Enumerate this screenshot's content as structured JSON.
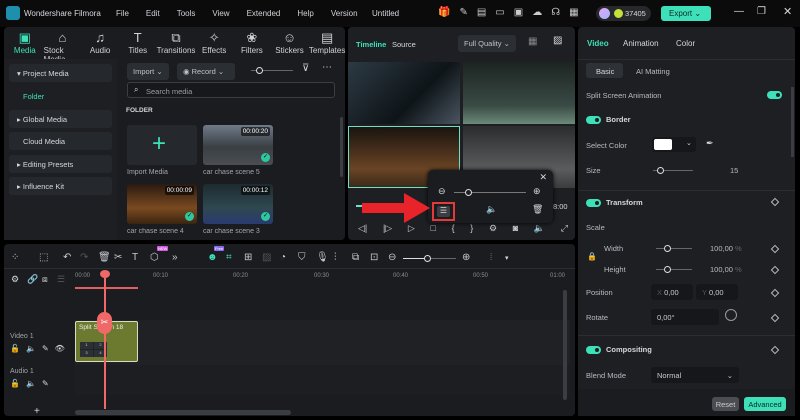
{
  "app": {
    "name": "Wondershare Filmora",
    "project_title": "Untitled",
    "credits": "37405",
    "export_label": "Export"
  },
  "menu": [
    "File",
    "Edit",
    "Tools",
    "View",
    "Extended",
    "Help",
    "Version"
  ],
  "toolbar_tabs": [
    {
      "label": "Media",
      "icon": "media-icon"
    },
    {
      "label": "Stock Media",
      "icon": "stock-media-icon"
    },
    {
      "label": "Audio",
      "icon": "audio-icon"
    },
    {
      "label": "Titles",
      "icon": "titles-icon"
    },
    {
      "label": "Transitions",
      "icon": "transitions-icon"
    },
    {
      "label": "Effects",
      "icon": "effects-icon"
    },
    {
      "label": "Filters",
      "icon": "filters-icon"
    },
    {
      "label": "Stickers",
      "icon": "stickers-icon"
    },
    {
      "label": "Templates",
      "icon": "templates-icon"
    }
  ],
  "media_sidebar": [
    "Project Media",
    "Folder",
    "Global Media",
    "Cloud Media",
    "Editing Presets",
    "Influence Kit"
  ],
  "media": {
    "import_label": "Import",
    "record_label": "Record",
    "search_placeholder": "Search media",
    "folder_heading": "FOLDER",
    "items": [
      {
        "name": "Import Media"
      },
      {
        "name": "car chase scene 5",
        "duration": "00:00:20"
      },
      {
        "name": "car chase scene 4",
        "duration": "00:00:09"
      },
      {
        "name": "car chase scene 3",
        "duration": "00:00:12"
      }
    ]
  },
  "preview": {
    "tabs": [
      "Timeline",
      "Source"
    ],
    "quality": "Full Quality",
    "time_end": "8:00",
    "popup_zoom_fraction": 0.2
  },
  "properties": {
    "tabs": [
      "Video",
      "Animation",
      "Color"
    ],
    "subtabs": [
      "Basic",
      "AI Matting"
    ],
    "split_screen_animation": "Split Screen Animation",
    "border": {
      "title": "Border",
      "select_color": "Select Color",
      "size_label": "Size",
      "size_value": "15"
    },
    "transform": {
      "title": "Transform",
      "scale": "Scale",
      "width_label": "Width",
      "width_value": "100,00",
      "height_label": "Height",
      "height_value": "100,00",
      "unit": "%",
      "position_label": "Position",
      "x_label": "X",
      "x_value": "0,00",
      "y_label": "Y",
      "y_value": "0,00",
      "rotate_label": "Rotate",
      "rotate_value": "0,00°"
    },
    "compositing": {
      "title": "Compositing",
      "blend_label": "Blend Mode",
      "blend_value": "Normal"
    },
    "reset": "Reset",
    "advanced": "Advanced"
  },
  "timeline": {
    "ticks": [
      "00:00",
      "00:10",
      "00:20",
      "00:30",
      "00:40",
      "00:50",
      "01:00"
    ],
    "new_badge": "NEW",
    "free_badge": "Free",
    "video_track": "Video 1",
    "audio_track": "Audio 1",
    "clip_name": "Split Screen 18",
    "clip_cells": [
      "1",
      "2",
      "3",
      "4"
    ],
    "add": "+"
  }
}
